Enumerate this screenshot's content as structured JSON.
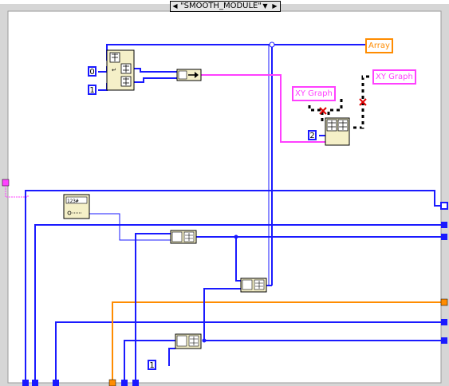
{
  "case_selector": {
    "label": "\"SMOOTH_MODULE\"",
    "decrement_arrow": "◀",
    "increment_arrow": "▶",
    "dropdown_arrow": "▼"
  },
  "indicators": {
    "array": "Array",
    "xy_graph_left": "XY Graph",
    "xy_graph_right": "XY Graph"
  },
  "constants": {
    "zero": "0",
    "one_top": "1",
    "two": "2",
    "one_bottom": "1"
  },
  "icons": [
    "build-cluster-array-icon",
    "index-array-icon",
    "bundle-icon",
    "unbundle-by-name-icon",
    "broken-wire-icon"
  ],
  "colors": {
    "integer_wire": "#1a1aff",
    "cluster_wire": "#ff40ff",
    "orange_wire": "#ff8c00",
    "broken_wire": "#000000",
    "structure_frame": "#d6d6d6"
  }
}
